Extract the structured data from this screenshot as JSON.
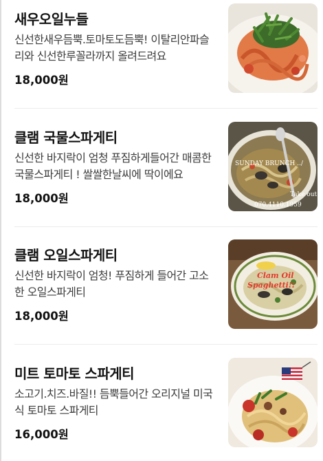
{
  "menu": {
    "items": [
      {
        "name": "새우오일누들",
        "description": "신선한새우듬뿍.토마토도듬뿍! 이탈리안파슬리와 신선한루꼴라까지 올려드려요",
        "price": "18,000원",
        "image": "shrimp-oil-noodle-photo"
      },
      {
        "name": "클램 국물스파게티",
        "description": "신선한 바지락이 엄청 푸짐하게들어간 매콤한 국물스파게티 ! 쌀쌀한날씨에 딱이에요",
        "price": "18,000원",
        "image": "clam-soup-spaghetti-photo",
        "overlay_top": "SUNDAY BRUNCH ../",
        "overlay_mid": "Take out",
        "overlay_phone": "070.4110.1959"
      },
      {
        "name": "클램 오일스파게티",
        "description": "신선한 바지락이 엄청! 푸짐하게 들어간 고소한 오일스파게티",
        "price": "18,000원",
        "image": "clam-oil-spaghetti-photo",
        "overlay_line1": "Clam Oil",
        "overlay_line2": "Spaghetti!!"
      },
      {
        "name": "미트 토마토 스파게티",
        "description": "소고기.치즈.바질!! 듬뿍들어간 오리지널 미국식 토마토 스파게티",
        "price": "16,000원",
        "image": "meat-tomato-spaghetti-photo"
      }
    ]
  },
  "colors": {
    "text": "#111111",
    "description": "#3d3d3d",
    "divider": "#ececec"
  }
}
